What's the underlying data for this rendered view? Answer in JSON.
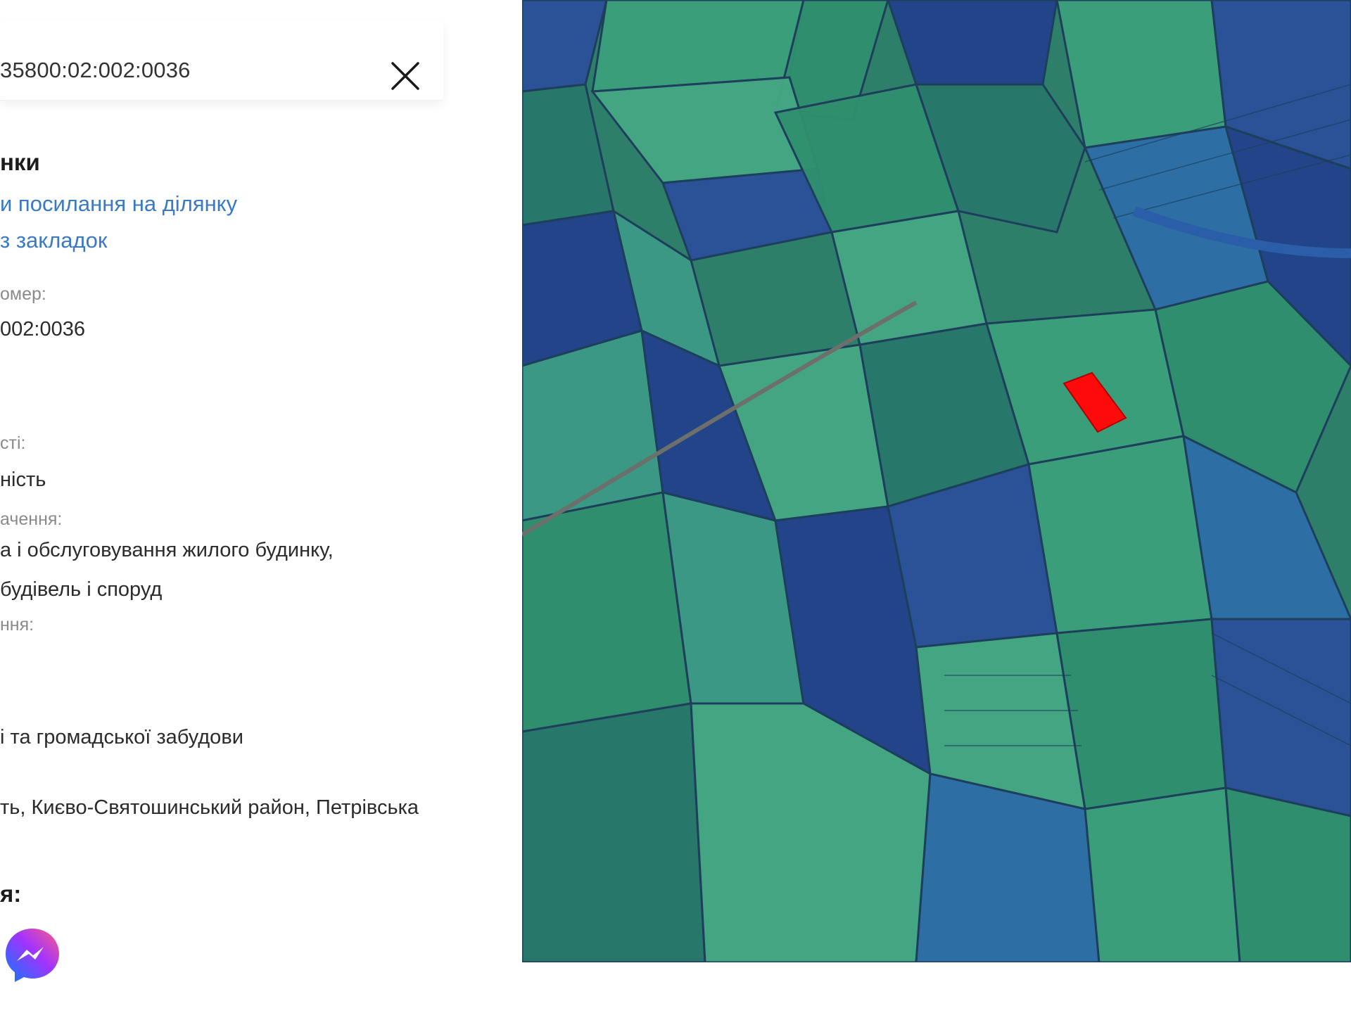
{
  "search": {
    "value": "35800:02:002:0036"
  },
  "icons": {
    "close": "close-icon",
    "messenger": "messenger-icon"
  },
  "parcel": {
    "section_title": "нки",
    "copy_link_label": "и посилання на ділянку",
    "bookmark_label": "з закладок",
    "cadastral_label": "омер:",
    "cadastral_value": "002:0036",
    "ownership_label": "сті:",
    "ownership_value": "ність",
    "purpose_label": "ачення:",
    "purpose_line1": "а і обслуговування жилого будинку,",
    "purpose_line2": "будівель і споруд",
    "usage_label": "ння:",
    "category_value": "і та громадської забудови",
    "address_value": "ть, Києво-Святошинський район, Петрівська"
  },
  "share": {
    "title": "я:"
  },
  "map": {
    "highlight_color": "#ff0a0a",
    "field_colors": [
      "#2f8f6e",
      "#3aa07a",
      "#27776a",
      "#2b4f9a",
      "#22418a",
      "#3c9a86",
      "#2d6fa8",
      "#44a884"
    ]
  }
}
